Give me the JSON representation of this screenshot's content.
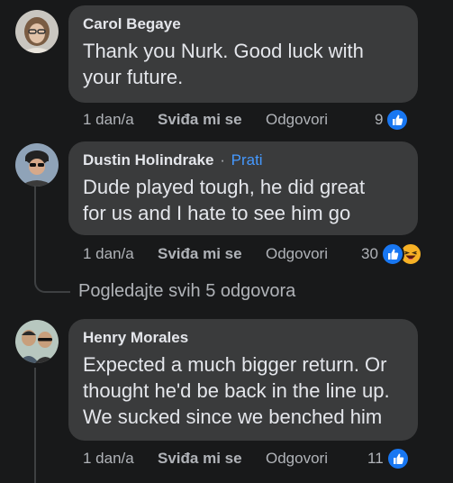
{
  "comments": [
    {
      "author": "Carol Begaye",
      "text_lines": [
        "Thank you Nurk. Good luck with",
        "your future."
      ],
      "time": "1 dan/a",
      "like_label": "Sviđa mi se",
      "reply_label": "Odgovori",
      "reaction_count": "9",
      "reactions": [
        "like"
      ]
    },
    {
      "author": "Dustin Holindrake",
      "separator": "·",
      "follow_label": "Prati",
      "text_lines": [
        "Dude played tough, he did great",
        "for us and I hate to see him go"
      ],
      "time": "1 dan/a",
      "like_label": "Sviđa mi se",
      "reply_label": "Odgovori",
      "reaction_count": "30",
      "reactions": [
        "like",
        "haha"
      ]
    },
    {
      "author": "Henry Morales",
      "text_lines": [
        "Expected a much bigger return. Or",
        "thought he'd be back in the line up.",
        "We sucked since we benched him"
      ],
      "time": "1 dan/a",
      "like_label": "Sviđa mi se",
      "reply_label": "Odgovori",
      "reaction_count": "11",
      "reactions": [
        "like"
      ]
    }
  ],
  "view_replies_label": "Pogledajte svih 5 odgovora",
  "colors": {
    "background": "#18191a",
    "bubble": "#3a3b3c",
    "primary_text": "#e4e6eb",
    "secondary_text": "#b0b3b8",
    "link_blue": "#4599ff",
    "like_blue": "#1877f2",
    "haha_yellow": "#f7b125"
  },
  "icons": [
    "like-reaction-icon",
    "haha-reaction-icon"
  ]
}
